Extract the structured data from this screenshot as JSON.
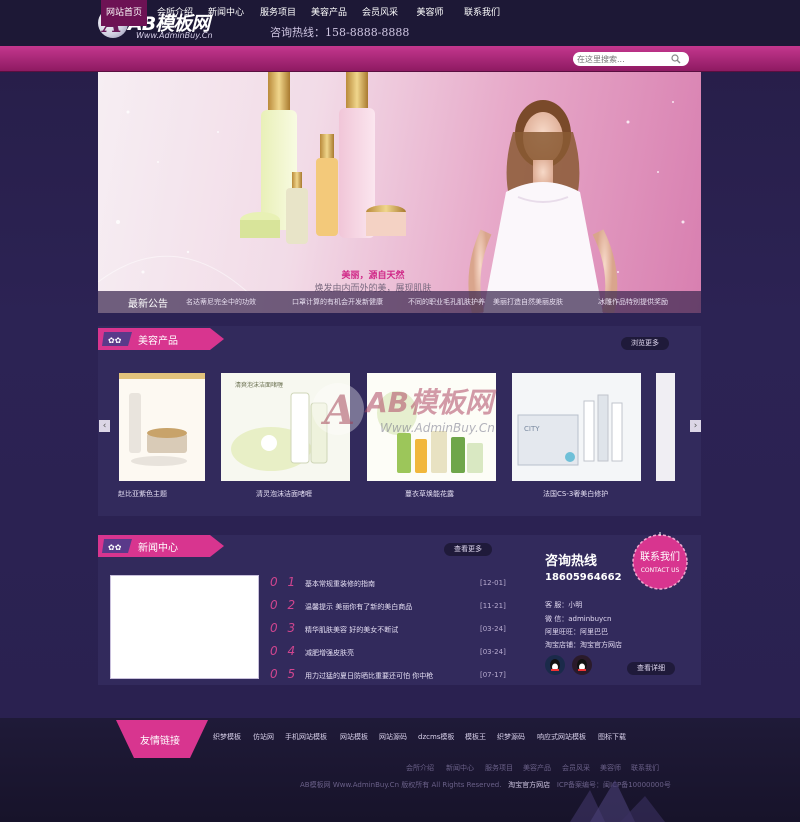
{
  "header": {
    "logo_text": "AB模板网",
    "logo_letter": "A",
    "logo_url": "Www.AdminBuy.Cn",
    "hotline": "咨询热线：158-8888-8888"
  },
  "nav": {
    "items": [
      "网站首页",
      "会所介绍",
      "新闻中心",
      "服务项目",
      "美容产品",
      "会员风采",
      "美容师",
      "联系我们"
    ],
    "active_index": 0,
    "search_placeholder": "在这里搜索..."
  },
  "banner": {
    "slogan_line1": "美丽，源自天然",
    "slogan_line2": "焕发由内而外的美，展现肌肤"
  },
  "notice": {
    "title": "最新公告",
    "items": [
      "名达蒂尼完全中的功效",
      "口罩计算的有机会开发新健康",
      "不同的职业毛孔肌肤护养",
      "美丽打造自然美丽皮肤",
      "冰雕作品特别提供奖励"
    ]
  },
  "products": {
    "title": "美容产品",
    "more": "浏览更多",
    "items": [
      {
        "name": "赵比亚紫色主题"
      },
      {
        "name": "清灵泡沫洁面啫喱"
      },
      {
        "name": "蔓衣草焕能花露"
      },
      {
        "name": "法国CS-3奢美白修护"
      }
    ]
  },
  "news": {
    "title": "新闻中心",
    "more": "查看更多",
    "items": [
      {
        "num": "01",
        "text": "基本常规重装修的指南",
        "date": "[12-01]"
      },
      {
        "num": "02",
        "text": "温馨提示 美丽你有了新的美白商品",
        "date": "[11-21]"
      },
      {
        "num": "03",
        "text": "精华肌肤美容 好的美女不断试",
        "date": "[03-24]"
      },
      {
        "num": "04",
        "text": "减肥增强皮肤亮",
        "date": "[03-24]"
      },
      {
        "num": "05",
        "text": "用力过猛的夏日防晒比重要还可怕 你中枪",
        "date": "[07-17]"
      }
    ]
  },
  "contact": {
    "bubble_line1": "联系我们",
    "bubble_line2": "CONTACT US",
    "title": "咨询热线",
    "phone": "18605964662",
    "lines": [
      "客 服：小明",
      "微 信：adminbuycn",
      "阿里旺旺：阿里巴巴",
      "淘宝店铺：淘宝官方网店"
    ],
    "detail_button": "查看详细"
  },
  "footer": {
    "links_title": "友情链接",
    "links": [
      "织梦模板",
      "仿站网",
      "手机网站模板",
      "网站模板",
      "网站源码",
      "dzcms模板",
      "模板王",
      "织梦源码",
      "响应式网站模板",
      "图标下载"
    ],
    "nav": [
      "会所介绍",
      "新闻中心",
      "服务项目",
      "美容产品",
      "会员风采",
      "美容师",
      "联系我们"
    ],
    "copyright": "AB模板网 Www.AdminBuy.Cn 版权所有 All Rights Reserved.",
    "shop": "淘宝官方网店",
    "icp": "ICP备案编号：闽ICP备10000000号"
  },
  "colors": {
    "accent": "#c4378e",
    "background": "#2a2150",
    "panel": "#322a5c"
  }
}
